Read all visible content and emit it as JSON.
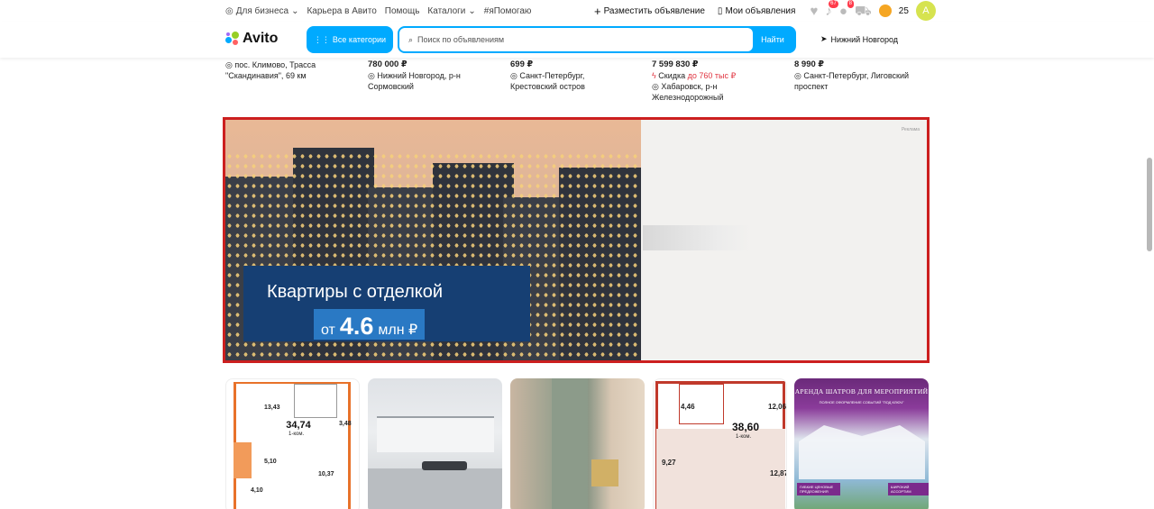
{
  "topbar": {
    "for_business": "Для бизнеса",
    "career": "Карьера в Авито",
    "help": "Помощь",
    "catalogs": "Каталоги",
    "ya_pomogayu": "#яПомогаю",
    "post_ad": "Разместить объявление",
    "my_ads": "Мои объявления",
    "notifications_count": "67",
    "messages_count": "8",
    "wallet": "25",
    "avatar_letter": "A"
  },
  "header": {
    "logo": "Avito",
    "all_categories": "Все категории",
    "search_placeholder": "Поиск по объявлениям",
    "search_button": "Найти",
    "location": "Нижний Новгород"
  },
  "listings": [
    {
      "price": "",
      "lines": [
        "пос. Климово, Трасса",
        "\"Скандинавия\", 69 км"
      ],
      "discount": ""
    },
    {
      "price": "780 000 ₽",
      "lines": [
        "Нижний Новгород, р-н",
        "Сормовский"
      ],
      "discount": ""
    },
    {
      "price": "699 ₽",
      "lines": [
        "Санкт-Петербург,",
        "Крестовский остров"
      ],
      "discount": ""
    },
    {
      "price": "7 599 830 ₽",
      "lines": [
        "Хабаровск, р-н",
        "Железнодорожный"
      ],
      "discount_prefix": "Скидка",
      "discount": "до 760 тыс ₽"
    },
    {
      "price": "8 990 ₽",
      "lines": [
        "Санкт-Петербург, Лиговский",
        "проспект"
      ],
      "discount": ""
    }
  ],
  "ad": {
    "label": "Реклама",
    "headline": "Квартиры с отделкой",
    "price_prefix": "от",
    "price_value": "4.6",
    "price_suffix": "млн ₽"
  },
  "cards": {
    "c1": {
      "area": "34,74",
      "rooms": "1-ком.",
      "r1": "13,43",
      "r2": "3,48",
      "r3": "5,10",
      "r4": "10,37",
      "r5": "4,10"
    },
    "c4": {
      "area": "38,60",
      "rooms": "1-ком.",
      "r1": "4,46",
      "r2": "12,06",
      "r3": "9,27",
      "r4": "12,87"
    },
    "c5": {
      "title": "АРЕНДА ШАТРОВ  ДЛЯ МЕРОПРИЯТИЙ",
      "subtitle": "ПОЛНОЕ ОФОРМЛЕНИЕ СОБЫТИЙ \"ПОД КЛЮЧ\"",
      "tag_left": "ГИБКИЕ ЦЕНОВЫЕ ПРЕДЛОЖЕНИЯ",
      "tag_right": "ШИРОКИЙ АССОРТИМ"
    }
  },
  "colors": {
    "accent": "#00aaff",
    "ad_border": "#cc1f1f",
    "discount": "#e0333f"
  }
}
